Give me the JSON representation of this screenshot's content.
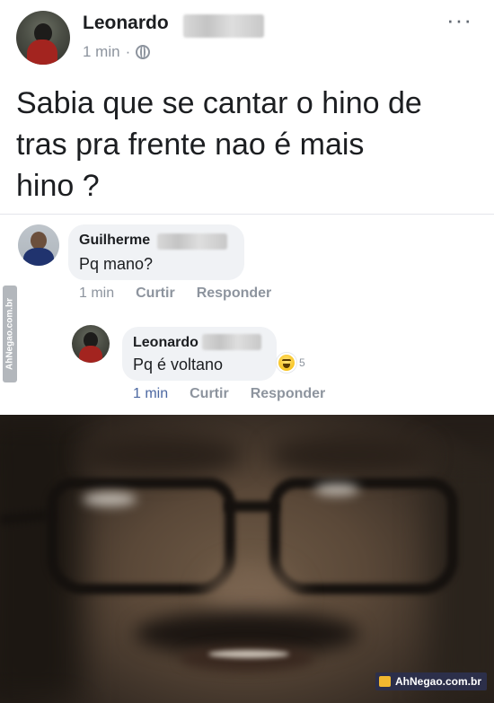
{
  "post": {
    "author": "Leonardo",
    "time": "1 min",
    "separator": "·",
    "more_icon": "···",
    "text": "Sabia que se cantar o hino de\ntras pra frente nao é mais\nhino ?"
  },
  "comments": [
    {
      "author": "Guilherme",
      "text": "Pq mano?",
      "time": "1 min",
      "like": "Curtir",
      "reply": "Responder"
    },
    {
      "author": "Leonardo",
      "text": "Pq é voltano",
      "time": "1 min",
      "like": "Curtir",
      "reply": "Responder",
      "reaction_icon": "haha-icon",
      "reaction_count": "5"
    }
  ],
  "watermarks": {
    "side": "AhNegao.com.br",
    "badge": "AhNegao.com.br"
  },
  "colors": {
    "link_blue": "#4b67a1",
    "meta_gray": "#8d949e",
    "bubble_bg": "#f0f2f5"
  }
}
